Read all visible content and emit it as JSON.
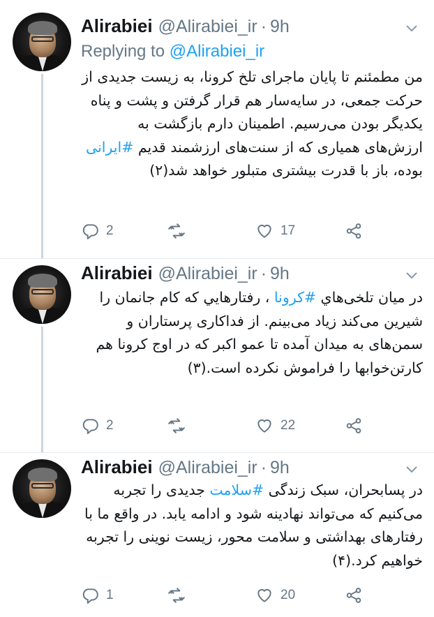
{
  "tweets": [
    {
      "author": {
        "name": "Alirabiei",
        "handle": "@Alirabiei_ir",
        "separator": "·",
        "time": "9h"
      },
      "replying": {
        "prefix": "Replying to ",
        "to": "@Alirabiei_ir"
      },
      "text": {
        "part1": "من مطمئنم تا پایان ماجرای تلخ کرونا، به زیست جدیدی از حرکت جمعی، در سایه‌سار هم قرار گرفتن و پشت و پناه یکدیگر بودن می‌رسیم. اطمینان دارم بازگشت به ارزش‌های همیاری که از سنت‌های ارزشمند قدیم ",
        "hashtag": "#ایرانی",
        "part2": " بوده، باز با قدرت بیشتری متبلور خواهد شد(۲)"
      },
      "counts": {
        "replies": "2",
        "retweets": "",
        "likes": "17"
      }
    },
    {
      "author": {
        "name": "Alirabiei",
        "handle": "@Alirabiei_ir",
        "separator": "·",
        "time": "9h"
      },
      "text": {
        "part1": "در میان تلخی‌هاي ",
        "hashtag": "#کرونا",
        "part2": " ، رفتارهایي که کام جانمان را شیرین می‌کند زیاد می‌بینم. از فداکاری پرستاران و سمن‌های به میدان آمده تا عمو اکبر که در اوج کرونا هم کارتن‌خوابها را فراموش نکرده است.(۳)"
      },
      "counts": {
        "replies": "2",
        "retweets": "",
        "likes": "22"
      }
    },
    {
      "author": {
        "name": "Alirabiei",
        "handle": "@Alirabiei_ir",
        "separator": "·",
        "time": "9h"
      },
      "text": {
        "part1": "در پسابحران، سبک زندگی ",
        "hashtag": "#سلامت",
        "part2": " جدیدی را تجربه می‌کنیم که می‌تواند نهادینه شود و ادامه یابد. در واقع ما با رفتارهای بهداشتی و سلامت محور، زیست نوینی را تجربه خواهیم کرد.(۴)"
      },
      "counts": {
        "replies": "1",
        "retweets": "",
        "likes": "20"
      }
    }
  ],
  "icons": [
    "reply-icon",
    "retweet-icon",
    "like-icon",
    "share-icon",
    "chevron-down-icon"
  ],
  "colors": {
    "link": "#1da1f2",
    "muted": "#657786",
    "text": "#14171a",
    "thread_line": "#ccd6dd",
    "divider": "#e6ecf0"
  }
}
